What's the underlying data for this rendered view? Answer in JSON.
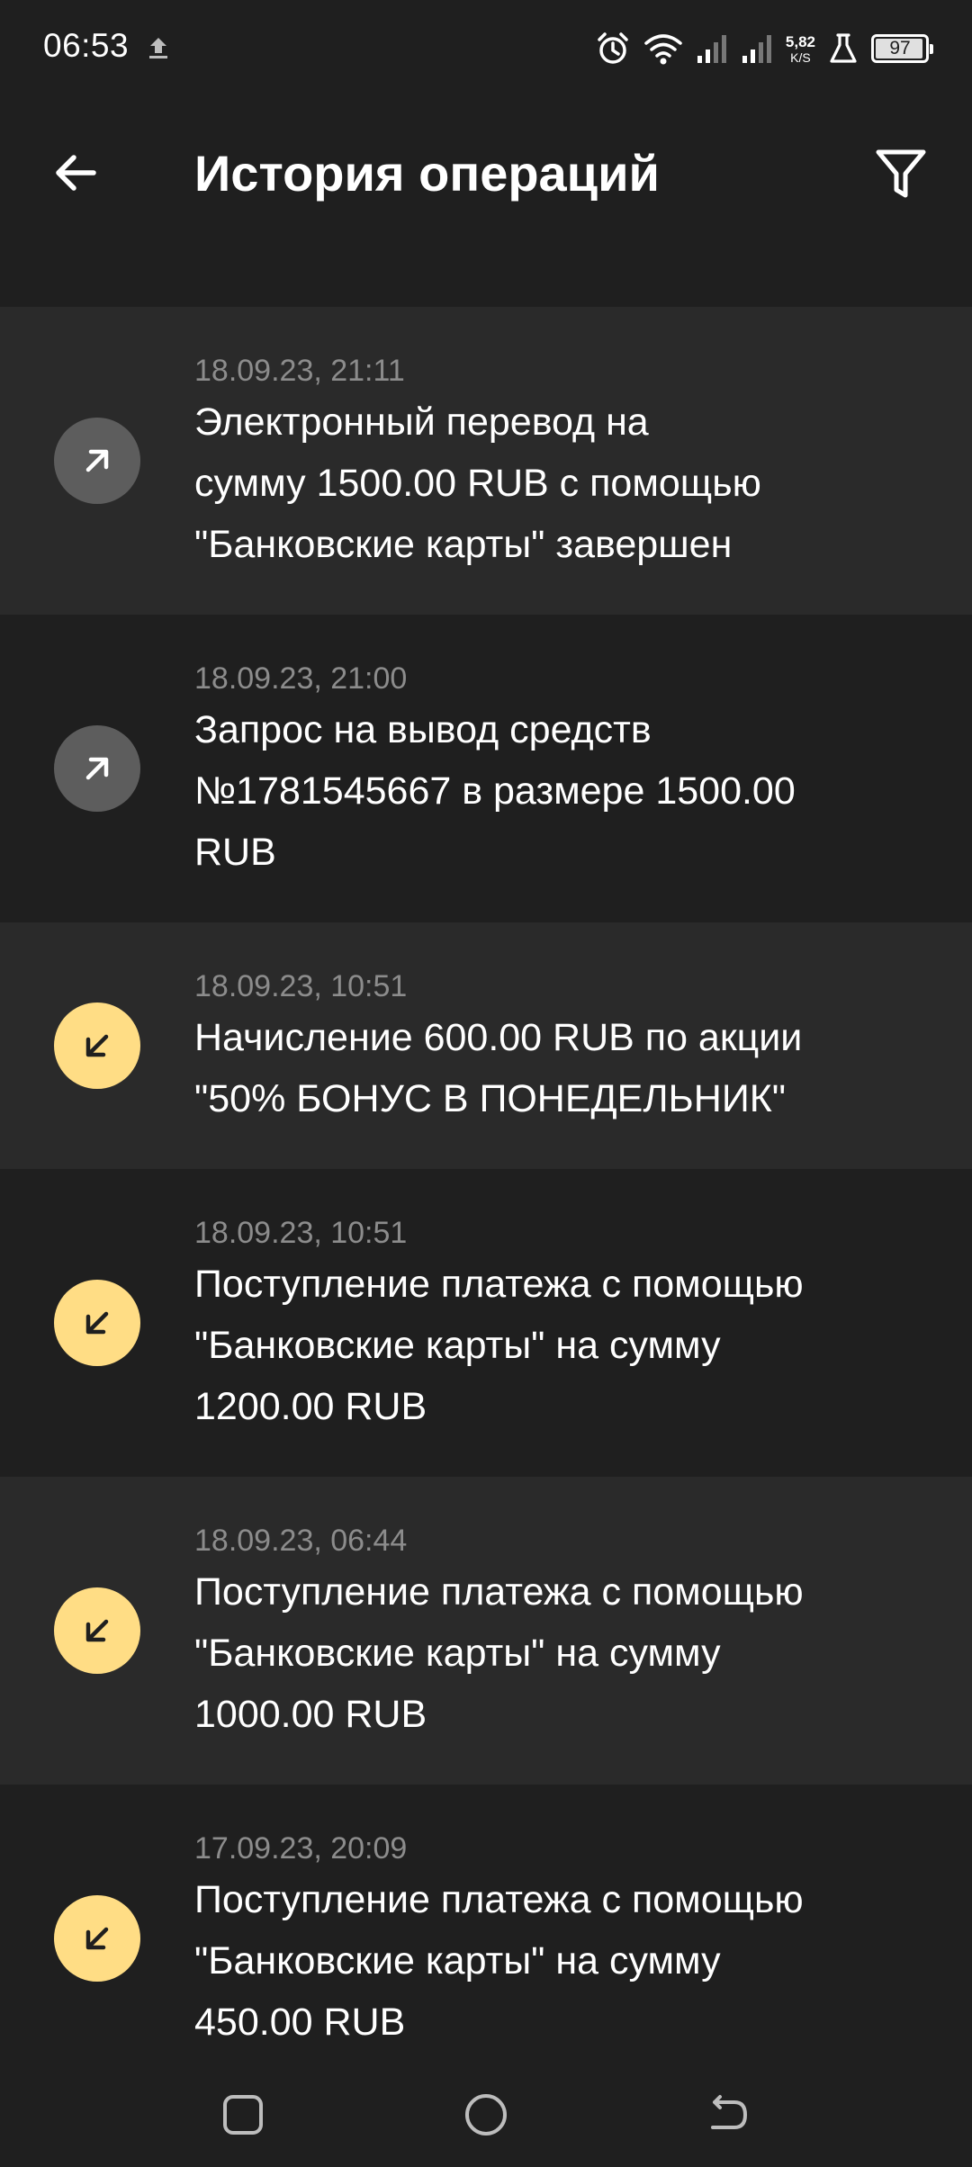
{
  "status_bar": {
    "time": "06:53",
    "net_speed_value": "5,82",
    "net_speed_unit": "K/S",
    "battery": "97",
    "battery_level": 0.97,
    "icons": [
      "upload-icon",
      "alarm-icon",
      "wifi-icon",
      "signal-icon",
      "signal-icon",
      "lab-icon",
      "battery-icon"
    ]
  },
  "header": {
    "title": "История операций",
    "back_icon": "arrow-left-icon",
    "filter_icon": "filter-icon"
  },
  "colors": {
    "background": "#1f1f1f",
    "row_alt": "#2a2a2a",
    "outgoing_icon_bg": "#5d5d5d",
    "incoming_icon_bg": "#ffdd85"
  },
  "operations": [
    {
      "date": "18.09.23, 21:11",
      "lines": [
        "Электронный перевод на",
        "сумму 1500.00 RUB с помощью",
        "\"Банковские карты\" завершен"
      ],
      "direction": "out"
    },
    {
      "date": "18.09.23, 21:00",
      "lines": [
        "Запрос на вывод средств",
        "№1781545667 в размере 1500.00",
        "RUB"
      ],
      "direction": "out"
    },
    {
      "date": "18.09.23, 10:51",
      "lines": [
        "Начисление 600.00 RUB по акции",
        "\"50% БОНУС В ПОНЕДЕЛЬНИК\""
      ],
      "direction": "in"
    },
    {
      "date": "18.09.23, 10:51",
      "lines": [
        "Поступление платежа с помощью",
        "\"Банковские карты\" на сумму",
        "1200.00 RUB"
      ],
      "direction": "in"
    },
    {
      "date": "18.09.23, 06:44",
      "lines": [
        "Поступление платежа с помощью",
        "\"Банковские карты\" на сумму",
        "1000.00 RUB"
      ],
      "direction": "in"
    },
    {
      "date": "17.09.23, 20:09",
      "lines": [
        "Поступление платежа с помощью",
        "\"Банковские карты\" на сумму",
        "450.00 RUB"
      ],
      "direction": "in"
    }
  ],
  "nav_bar": {
    "icons": [
      "recents-icon",
      "home-icon",
      "back-icon"
    ]
  }
}
